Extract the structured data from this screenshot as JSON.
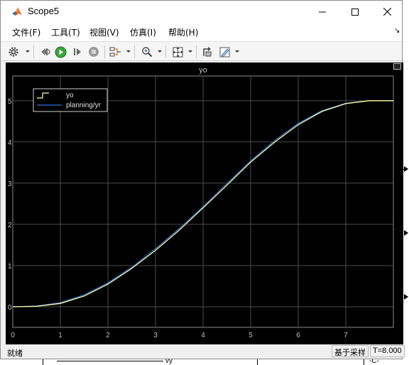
{
  "window": {
    "title": "Scope5"
  },
  "menu": [
    {
      "label": "文件(F)"
    },
    {
      "label": "工具(T)"
    },
    {
      "label": "视图(V)"
    },
    {
      "label": "仿真(I)"
    },
    {
      "label": "帮助(H)"
    }
  ],
  "toolbar": {
    "icons": [
      "gear-icon",
      "step-back-icon",
      "run-icon",
      "step-forward-icon",
      "stop-icon",
      "signal-select-icon",
      "zoom-icon",
      "autoscale-icon",
      "highlight-block-icon",
      "style-icon"
    ]
  },
  "statusbar": {
    "status": "就绪",
    "mode": "基于采样",
    "time": "T=8.000"
  },
  "background": {
    "label_vy": "vy",
    "label_c": "-C-"
  },
  "colors": {
    "plot_bg": "#000000",
    "grid": "#4d4d4d",
    "axis_text": "#bfbfbf",
    "series_yo": "#ffff9e",
    "series_yr": "#2f6fd6"
  },
  "chart_data": {
    "type": "line",
    "title": "yo",
    "xlim": [
      0,
      8
    ],
    "ylim": [
      -0.5,
      5.6
    ],
    "xticks": [
      "0",
      "1",
      "2",
      "3",
      "4",
      "5",
      "6",
      "7"
    ],
    "yticks": [
      "0",
      "1",
      "2",
      "3",
      "4",
      "5"
    ],
    "grid": true,
    "legend_position": "top-left",
    "x": [
      0,
      0.5,
      1.0,
      1.5,
      2.0,
      2.5,
      3.0,
      3.5,
      4.0,
      4.5,
      5.0,
      5.5,
      6.0,
      6.5,
      7.0,
      7.5,
      8.0
    ],
    "series": [
      {
        "name": "yo",
        "values": [
          0,
          0.01,
          0.08,
          0.26,
          0.55,
          0.93,
          1.37,
          1.86,
          2.4,
          2.95,
          3.51,
          3.99,
          4.42,
          4.74,
          4.93,
          5.0,
          5.0
        ]
      },
      {
        "name": "planning/yr",
        "values": [
          0,
          0.02,
          0.1,
          0.29,
          0.58,
          0.96,
          1.41,
          1.9,
          2.43,
          2.99,
          3.54,
          4.03,
          4.45,
          4.76,
          4.94,
          5.0,
          5.0
        ]
      }
    ]
  }
}
